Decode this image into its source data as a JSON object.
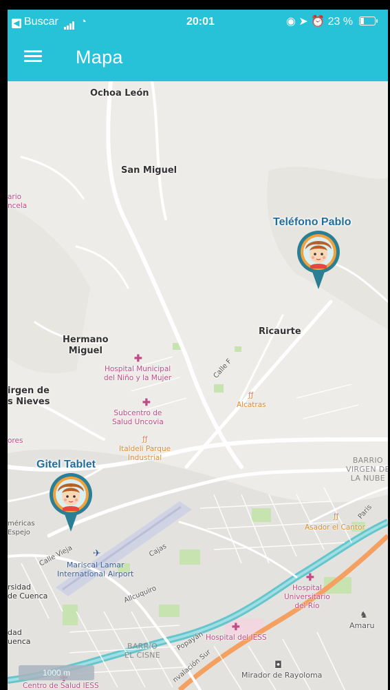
{
  "status_bar": {
    "back_label": "Buscar",
    "time": "20:01",
    "battery": "23 %"
  },
  "app_bar": {
    "title": "Mapa",
    "menu_icon": "hamburger-menu-icon"
  },
  "map": {
    "places": {
      "ochoa_leon": "Ochoa León",
      "san_miguel": "San Miguel",
      "ricaurte": "Ricaurte",
      "hermano_miguel": "Hermano\nMiguel",
      "virgen_nieves": "irgen de\ns Nieves",
      "edge_rio": "ario\nncela",
      "edge_res": "ores",
      "edge_mericas": "méricas\nEspejo",
      "edge_sidad": "rsidad\nde Cuenca",
      "edge_uenca": "dad\nuenca"
    },
    "pois": {
      "hospital_nino": "Hospital Municipal\ndel Niño y la Mujer",
      "subcentro": "Subcentro de\nSalud Uncovia",
      "alcatras": "Alcatras",
      "italdeli": "Italdeli Parque\nIndustrial",
      "asador": "Asador el Cantor",
      "hospital_rio": "Hospital\nUniversitario\ndel Río",
      "hospital_iess": "Hospital del IESS",
      "centro_iess": "Centro de Salud IESS",
      "mirador": "Mirador de Rayoloma",
      "amaru": "Amaru",
      "airport": "Mariscal Lamar\nInternational Airport"
    },
    "streets": {
      "calle_f": "Calle F",
      "calle_vieja": "Calle Vieja",
      "cajas": "Cajas",
      "allcuquiro": "Allcuquiro",
      "paris": "Paris",
      "popayan": "Popayán",
      "circunvalacion": "nvalación Sur"
    },
    "barrios": {
      "virgen_nube": "BARRIO\nVIRGEN DE\nLA NUBE",
      "el_cisne": "BARRIO\nEL CISNE"
    },
    "devices": [
      {
        "name": "Teléfono Pablo",
        "icon": "child-avatar-pin-icon"
      },
      {
        "name": "Gitel Tablet",
        "icon": "child-avatar-pin-icon"
      }
    ],
    "scale": "1000 m"
  },
  "colors": {
    "accent": "#27c1d8",
    "pin": "#2a7f95",
    "pin_ring": "#f2a23a",
    "river": "#4fbfc9",
    "highway": "#f4a060",
    "park": "#c7e3b0"
  }
}
